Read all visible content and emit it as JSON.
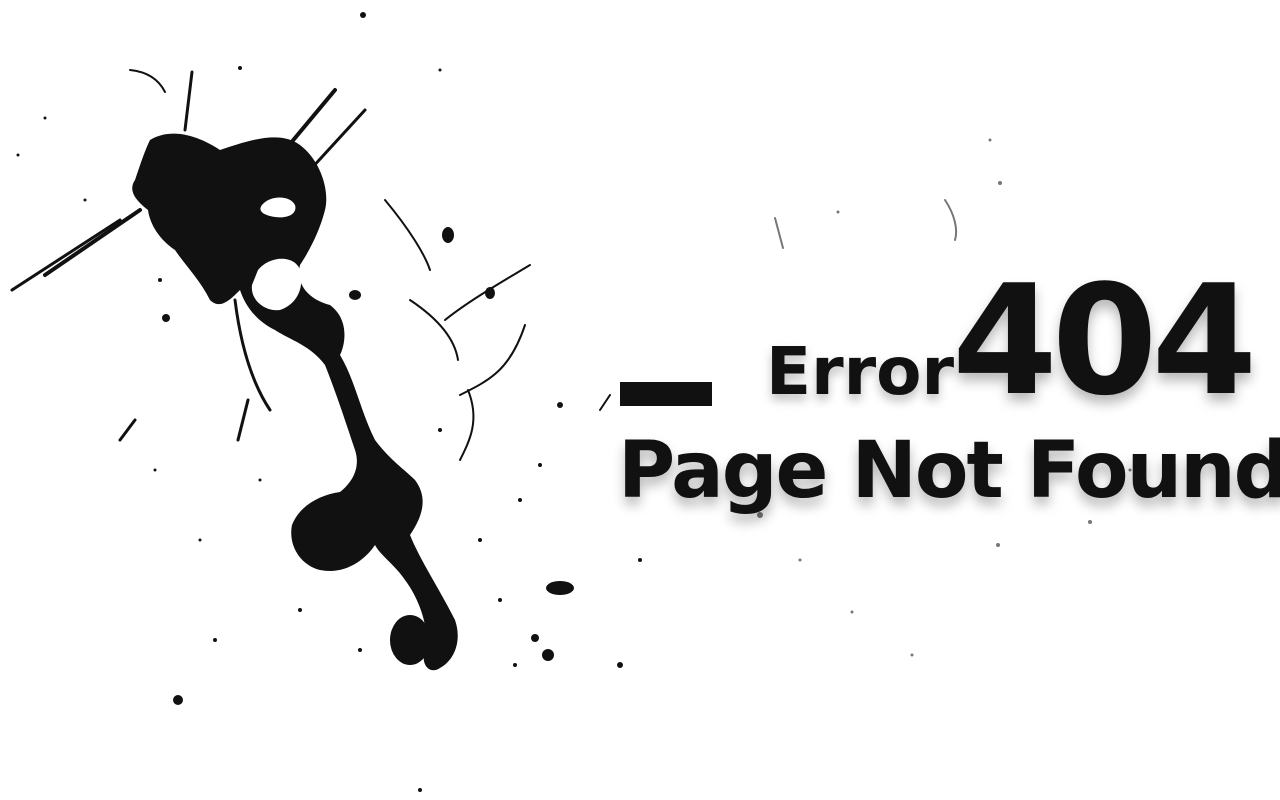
{
  "error": {
    "label": "Error",
    "code": "404",
    "message": "Page Not Found"
  },
  "colors": {
    "ink": "#111111",
    "background": "#ffffff"
  },
  "decorations": {
    "splatter": "ink-splatter-graphic"
  }
}
